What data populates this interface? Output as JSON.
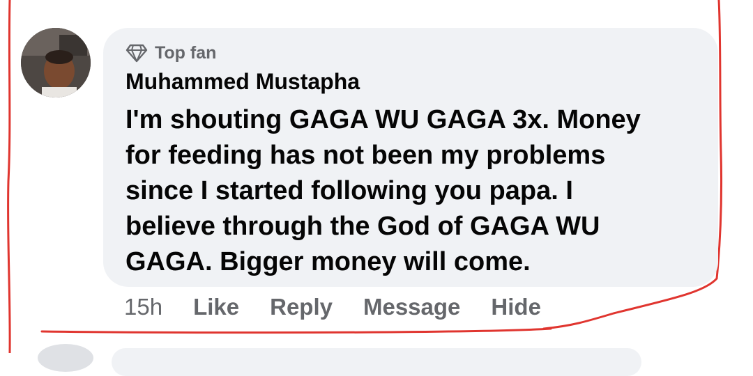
{
  "comment": {
    "badge_label": "Top fan",
    "badge_icon": "diamond-icon",
    "author": "Muhammed Mustapha",
    "text_lines": [
      "I'm shouting GAGA WU GAGA 3x. Money",
      "for feeding has not been my problems",
      "since I started following you papa. I",
      "believe through the God of GAGA WU",
      "GAGA. Bigger money will come."
    ],
    "timestamp": "15h",
    "actions": [
      "Like",
      "Reply",
      "Message",
      "Hide"
    ]
  },
  "colors": {
    "bubble_background": "#f0f2f5",
    "primary_text": "#050505",
    "secondary_text": "#65676b",
    "annotation_stroke": "#e0352f"
  }
}
